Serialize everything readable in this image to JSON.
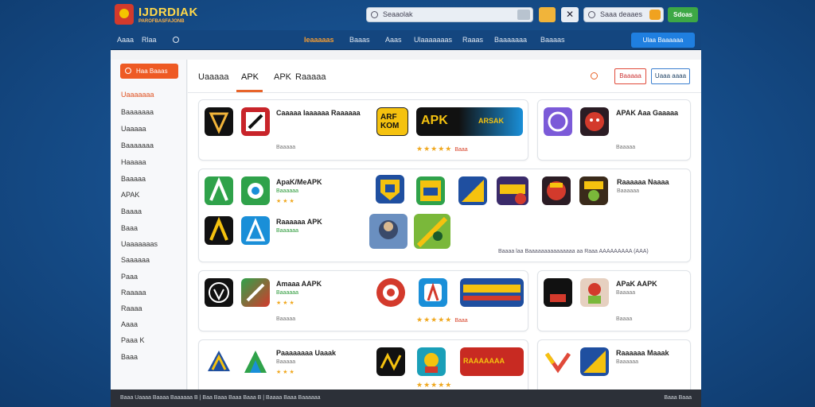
{
  "header": {
    "logo_text": "IJDRDIAK",
    "logo_sub": "PAROFBASFAJONB",
    "search_placeholder": "Seaaolak",
    "mini_search_placeholder": "Saaa deaaes",
    "action_button": "Sdoas"
  },
  "nav": {
    "items": [
      "Aaaa",
      "Rlaa",
      "Ieaaaaas",
      "Baaas",
      "Aaas",
      "Ulaaaaaaas",
      "Raaas",
      "Baaaaaaa",
      "Baaaas"
    ],
    "cta": "Ulaa Baaaaaa"
  },
  "sidebar": {
    "cta": "Haa Baaas",
    "items": [
      "Uaaaaaaa",
      "Baaaaaaa",
      "Uaaaaa",
      "Baaaaaaa",
      "Haaaaa",
      "Baaaaa",
      "APAK",
      "Baaaa",
      "Baaa",
      "Uaaaaaaas",
      "Saaaaaa",
      "Paaa",
      "Raaaaa",
      "Raaaa",
      "Aaaa",
      "Paaa K",
      "Baaa"
    ]
  },
  "tabs": {
    "items": [
      "Uaaaaa",
      "APK",
      "APK",
      "Raaaaa"
    ],
    "btn_red": "Baaaaa",
    "btn_blue": "Uaaa aaaa"
  },
  "cards": {
    "c1": {
      "title": "Caaaaa Iaaaaaa Raaaaaa",
      "meta": "Baaaaa",
      "banner1": "ARF KOM",
      "banner2": "APK",
      "banner2_sub": "ARSAK",
      "rating": "Baaa"
    },
    "c2": {
      "title": "APAK Aaa Gaaaaa",
      "meta": "Baaaaa"
    },
    "c3": {
      "title": "ApaK/MeAPK",
      "sub": "Baaaaaa",
      "meta": "Baaaa",
      "title2": "Raaaaaa APK",
      "sub2": "Baaaaaa"
    },
    "c4": {
      "title": "Raaaaaa Naaaa",
      "sub": "Baaaaaa"
    },
    "c3_foot": "Baaaa laa   Baaaaaaaaaaaaaaa aa Raaa AAAAAAAAA (AAA)",
    "c5": {
      "title": "Amaaa AAPK",
      "sub": "Baaaaaa",
      "meta": "Baaaaa",
      "rating": "Baaa"
    },
    "c6": {
      "title": "APaK AAPK",
      "sub": "Baaaaa",
      "meta": "Baaaa"
    },
    "c7": {
      "title": "Paaaaaaaa Uaaak",
      "sub": "Baaaaa",
      "meta": "Baaaa",
      "banner": "RAAAAAAA"
    },
    "c8": {
      "title": "Raaaaaa Maaak",
      "sub": "Baaaaaa"
    }
  },
  "footer": {
    "left": "Baaa  Uaaaa Baaaa Baaaaaa B  |  Baa Baaa  Baaa  Baaa B  |  Baaaa Baaa  Baaaaaa",
    "right": "Baaa  Baaa"
  },
  "colors": {
    "accent": "#e8642a",
    "nav": "#14467f",
    "background": "#17508e",
    "success": "#3da845"
  }
}
